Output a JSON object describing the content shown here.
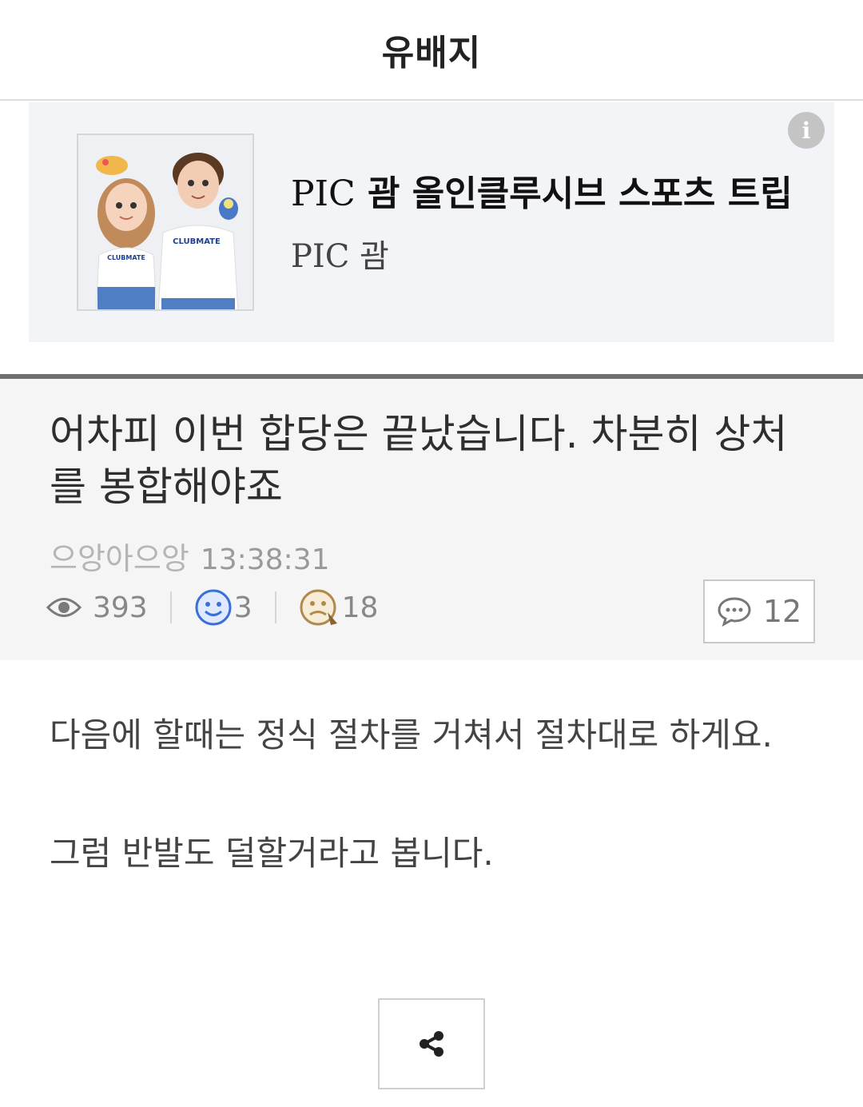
{
  "header": {
    "title": "유배지"
  },
  "ad": {
    "title_latin": "PIC",
    "title_rest": " 괌 올인클루시브 스포츠 트립",
    "subtitle": "PIC 괌",
    "info_glyph": "i",
    "image_icon": "couple-illustration-image"
  },
  "post": {
    "title": "어차피 이번 합당은 끝났습니다. 차분히 상처를 봉합해야죠",
    "author": "으앙아으앙",
    "time": "13:38:31",
    "stats": {
      "views": "393",
      "likes": "3",
      "dislikes": "18",
      "comments": "12"
    },
    "body": [
      "다음에 할때는 정식 절차를 거쳐서 절차대로 하게요.",
      "그럼 반발도 덜할거라고 봅니다."
    ]
  },
  "colors": {
    "accent_blue": "#3b6fd8",
    "dislike_brown": "#b08a4a",
    "divider": "#6f6f6f"
  }
}
